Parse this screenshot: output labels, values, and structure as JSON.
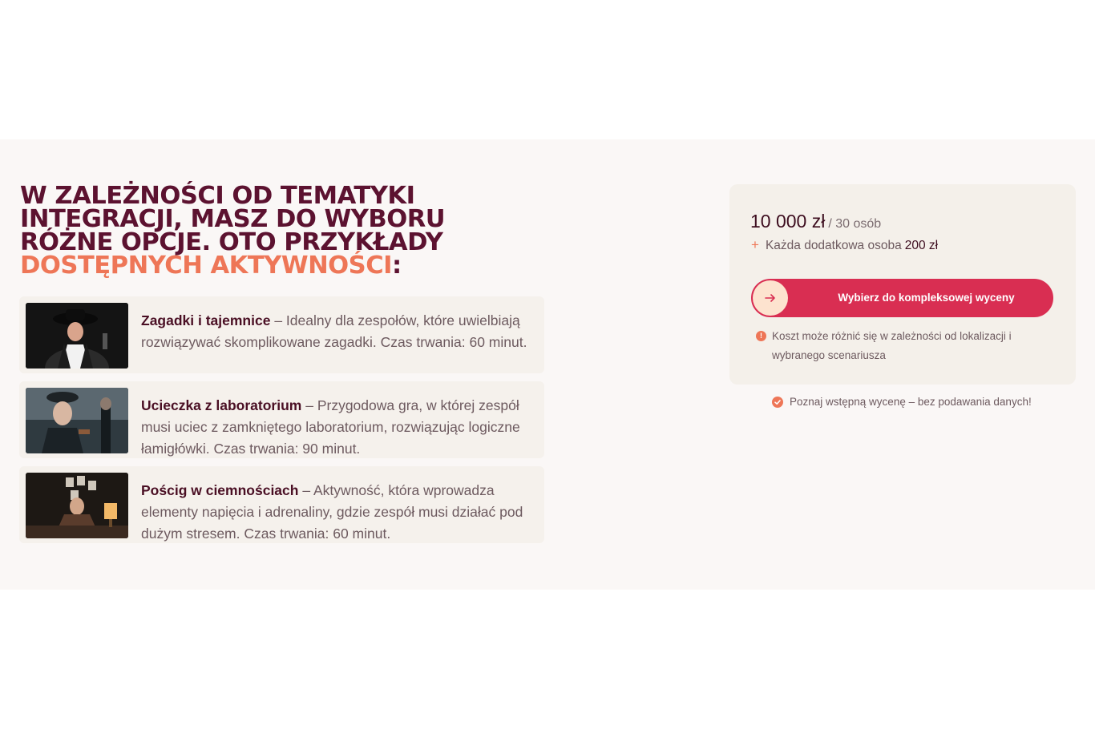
{
  "heading": {
    "line1": "W ZALEŻNOŚCI OD TEMATYKI",
    "line2": "INTEGRACJI, MASZ DO WYBORU",
    "line3": "RÓŻNE OPCJE. OTO PRZYKŁADY",
    "accent": "DOSTĘPNYCH AKTYWNOŚCI",
    "suffix": ":"
  },
  "activities": [
    {
      "title": "Zagadki i tajemnice",
      "description": " – Idealny dla zespołów, które uwielbiają rozwiązywać skomplikowane zagadki. Czas trwania: 60 minut."
    },
    {
      "title": "Ucieczka z laboratorium",
      "description": " – Przygodowa gra, w której zespół musi uciec z zamkniętego laboratorium, rozwiązując logiczne łamigłówki. Czas trwania: 90 minut."
    },
    {
      "title": "Pościg w ciemnościach",
      "description": " – Aktywność, która wprowadza elementy napięcia i adrenaliny, gdzie zespół musi działać pod dużym stresem. Czas trwania: 60 minut."
    }
  ],
  "pricing": {
    "price": "10 000 zł",
    "per": "/ 30 osób",
    "extra_label": "Każda dodatkowa osoba",
    "extra_price": "200 zł",
    "cta_label": "Wybierz do kompleksowej wyceny",
    "note": "Koszt może różnić się w zależności od lokalizacji i wybranego scenariusza",
    "guarantee": "Poznaj wstępną wycenę – bez podawania danych!"
  },
  "colors": {
    "brand_dark": "#5c1230",
    "accent": "#ee7657",
    "cta": "#d92e52"
  },
  "icons": {
    "cta_icon": "arrow-right-icon",
    "note_icon": "info-icon",
    "guarantee_icon": "check-badge-icon",
    "extra_icon": "plus-icon"
  }
}
